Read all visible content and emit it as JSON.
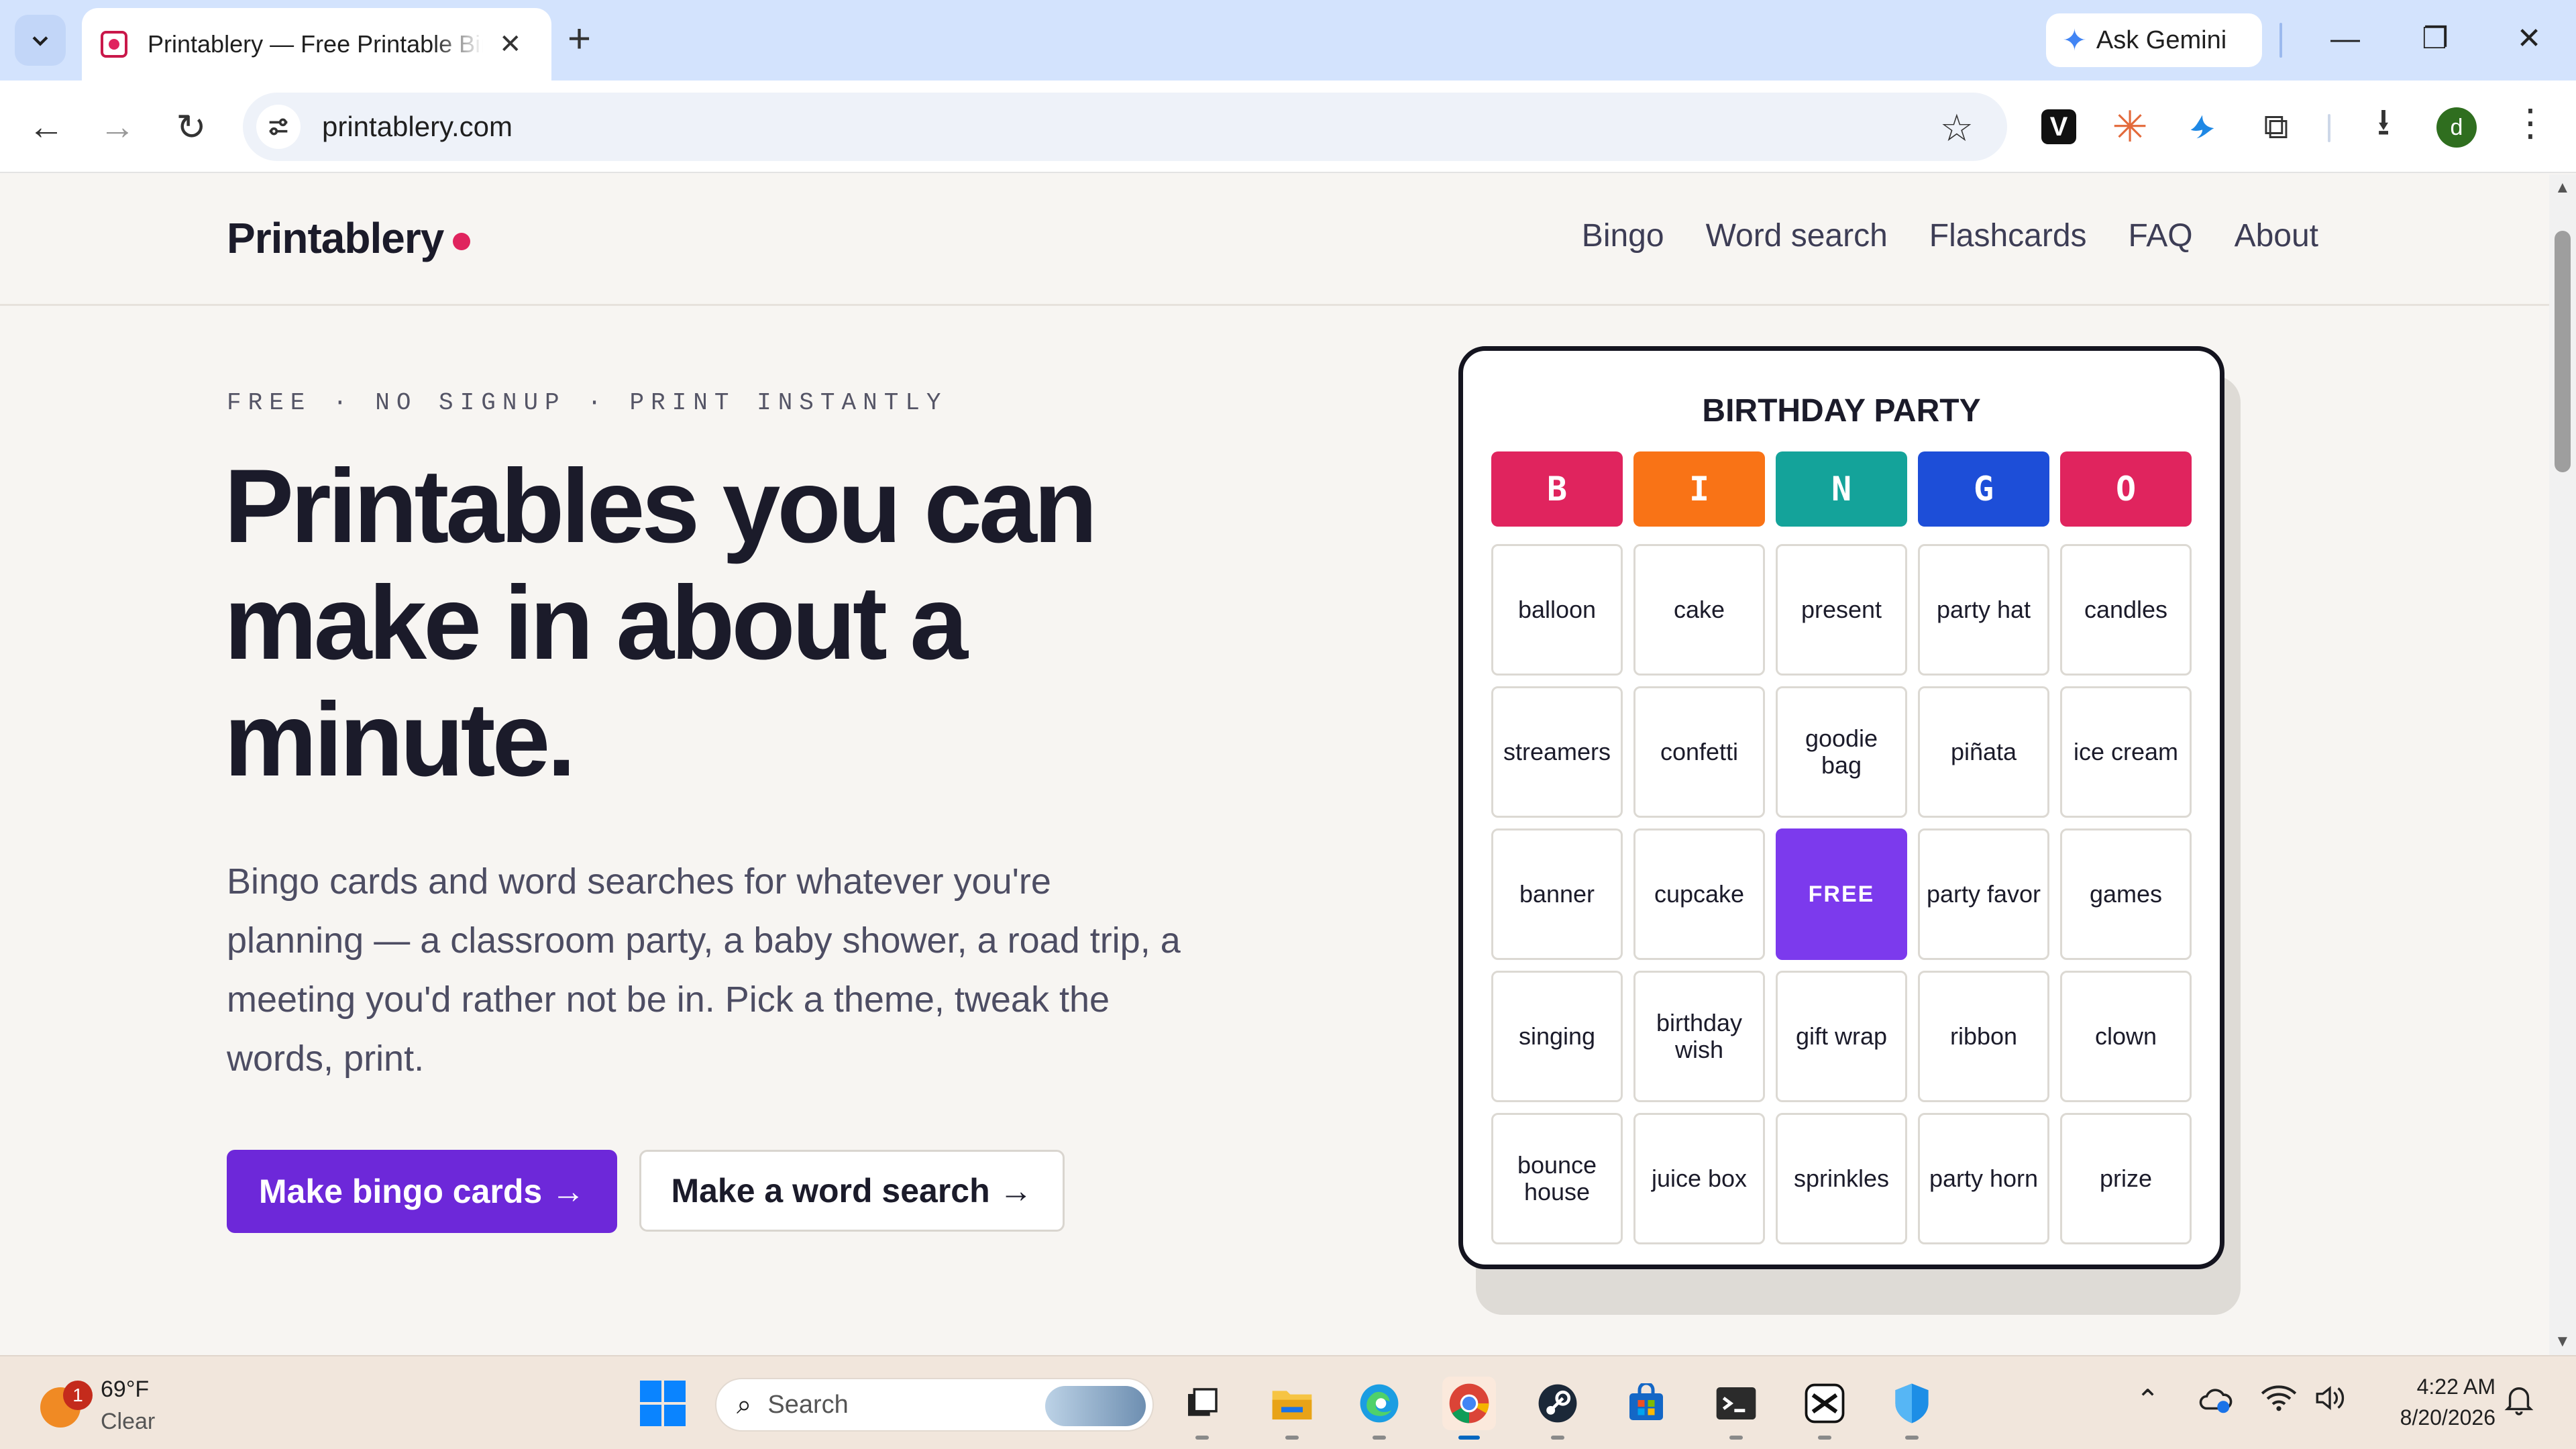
{
  "browser": {
    "tab": {
      "title": "Printablery — Free Printable Bingo Cards",
      "close": "✕"
    },
    "new_tab": "+",
    "gemini_label": "Ask Gemini",
    "window_controls": {
      "minimize": "—",
      "restore": "❐",
      "close": "✕"
    },
    "nav": {
      "back": "←",
      "forward": "→",
      "reload": "↻"
    },
    "url": "printablery.com",
    "bookmark": "☆",
    "extensions": {
      "v_label": "V",
      "claude": "✳",
      "puzzle": "⧉",
      "download": "⭳"
    },
    "profile_initial": "d",
    "menu": "⋮"
  },
  "site": {
    "logo": "Printablery",
    "nav": [
      "Bingo",
      "Word search",
      "Flashcards",
      "FAQ",
      "About"
    ]
  },
  "hero": {
    "eyebrow": "FREE · NO SIGNUP · PRINT INSTANTLY",
    "headline": "Printables you can make in about a minute.",
    "lede": "Bingo cards and word searches for whatever you're planning — a classroom party, a baby shower, a road trip, a meeting you'd rather not be in. Pick a theme, tweak the words, print.",
    "primary_cta": "Make bingo cards →",
    "secondary_cta": "Make a word search →"
  },
  "bingo_card": {
    "title": "BIRTHDAY PARTY",
    "headers": [
      {
        "letter": "B",
        "color": "#e0245e"
      },
      {
        "letter": "I",
        "color": "#f97316"
      },
      {
        "letter": "N",
        "color": "#14a39a"
      },
      {
        "letter": "G",
        "color": "#1d4ed8"
      },
      {
        "letter": "O",
        "color": "#e0245e"
      }
    ],
    "cells": [
      "balloon",
      "cake",
      "present",
      "party hat",
      "candles",
      "streamers",
      "confetti",
      "goodie bag",
      "piñata",
      "ice cream",
      "banner",
      "cupcake",
      "FREE",
      "party favor",
      "games",
      "singing",
      "birthday wish",
      "gift wrap",
      "ribbon",
      "clown",
      "bounce house",
      "juice box",
      "sprinkles",
      "party horn",
      "prize"
    ],
    "free_color": "#7c3aed"
  },
  "taskbar": {
    "weather": {
      "badge": "1",
      "temp": "69°F",
      "condition": "Clear"
    },
    "search_placeholder": "Search",
    "clock": {
      "time": "4:22 AM",
      "date": "8/20/2026"
    },
    "accent": "#0067c0"
  }
}
